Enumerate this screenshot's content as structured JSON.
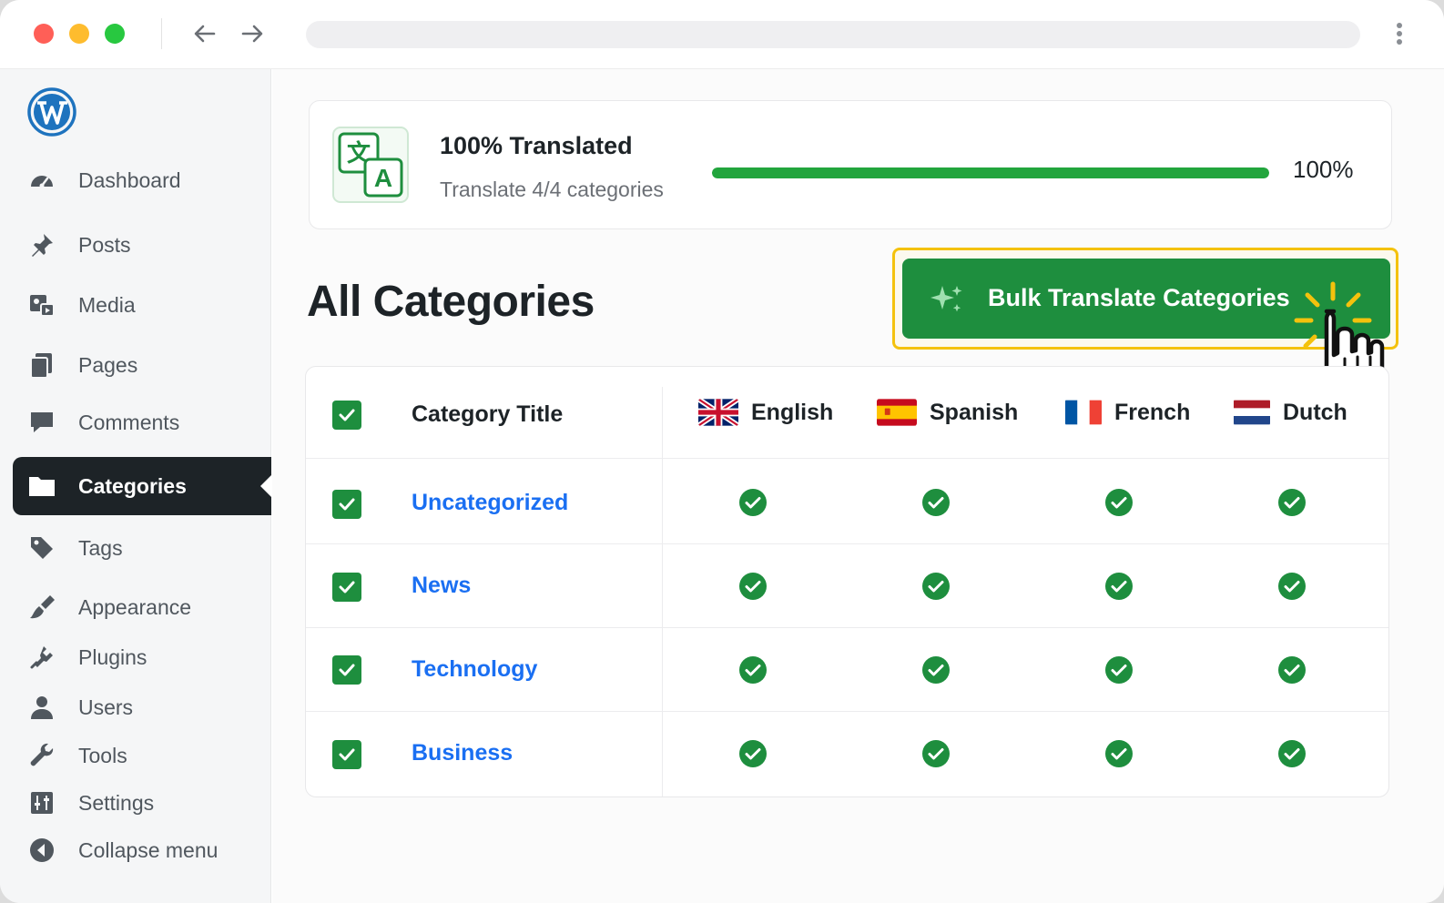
{
  "sidebar": {
    "items": [
      {
        "label": "Dashboard",
        "icon": "dashboard-icon"
      },
      {
        "label": "Posts",
        "icon": "pin-icon"
      },
      {
        "label": "Media",
        "icon": "media-icon"
      },
      {
        "label": "Pages",
        "icon": "pages-icon"
      },
      {
        "label": "Comments",
        "icon": "comment-icon"
      },
      {
        "label": "Categories",
        "icon": "folder-icon",
        "active": true
      },
      {
        "label": "Tags",
        "icon": "tag-icon"
      },
      {
        "label": "Appearance",
        "icon": "brush-icon"
      },
      {
        "label": "Plugins",
        "icon": "plugin-icon"
      },
      {
        "label": "Users",
        "icon": "user-icon"
      },
      {
        "label": "Tools",
        "icon": "wrench-icon"
      },
      {
        "label": "Settings",
        "icon": "sliders-icon"
      },
      {
        "label": "Collapse menu",
        "icon": "collapse-icon"
      }
    ]
  },
  "progress": {
    "title": "100% Translated",
    "subtitle": "Translate 4/4 categories",
    "percent_label": "100%",
    "fraction": 1.0
  },
  "main": {
    "page_title": "All Categories",
    "bulk_button_label": "Bulk Translate Categories"
  },
  "table": {
    "title_header": "Category Title",
    "languages": [
      {
        "name": "English",
        "flag": "uk-flag-icon"
      },
      {
        "name": "Spanish",
        "flag": "spain-flag-icon"
      },
      {
        "name": "French",
        "flag": "france-flag-icon"
      },
      {
        "name": "Dutch",
        "flag": "netherlands-flag-icon"
      }
    ],
    "rows": [
      {
        "title": "Uncategorized",
        "translated": [
          true,
          true,
          true,
          true
        ]
      },
      {
        "title": "News",
        "translated": [
          true,
          true,
          true,
          true
        ]
      },
      {
        "title": "Technology",
        "translated": [
          true,
          true,
          true,
          true
        ]
      },
      {
        "title": "Business",
        "translated": [
          true,
          true,
          true,
          true
        ]
      }
    ]
  },
  "colors": {
    "accent_green": "#1e8e3e",
    "progress_green": "#22a53d",
    "link_blue": "#1a6ff2",
    "highlight_yellow": "#f4c20d",
    "sidebar_active": "#1d2327"
  }
}
